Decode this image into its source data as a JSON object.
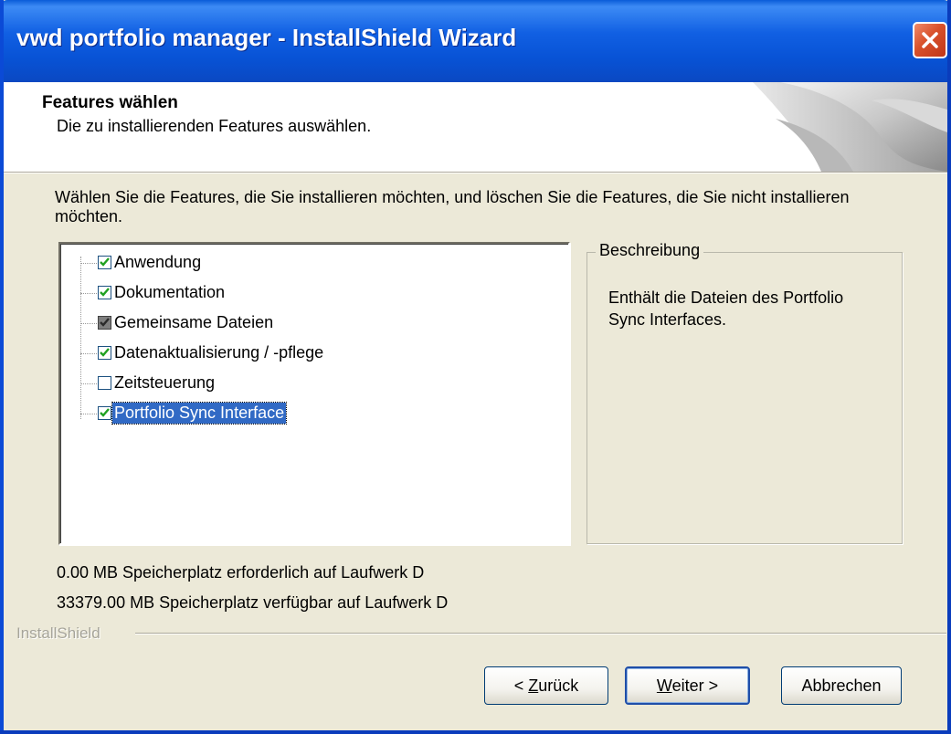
{
  "window": {
    "title": "vwd portfolio manager - InstallShield Wizard"
  },
  "header": {
    "title": "Features wählen",
    "subtitle": "Die zu installierenden Features auswählen."
  },
  "intro_text": "Wählen Sie die Features, die Sie installieren möchten, und löschen Sie die Features, die Sie nicht installieren möchten.",
  "features": [
    {
      "label": "Anwendung",
      "state": "checked"
    },
    {
      "label": "Dokumentation",
      "state": "checked"
    },
    {
      "label": "Gemeinsame Dateien",
      "state": "partial"
    },
    {
      "label": "Datenaktualisierung / -pflege",
      "state": "checked"
    },
    {
      "label": "Zeitsteuerung",
      "state": "unchecked"
    },
    {
      "label": "Portfolio Sync Interface",
      "state": "checked",
      "selected": true
    }
  ],
  "description": {
    "legend": "Beschreibung",
    "text": "Enthält die Dateien des Portfolio Sync Interfaces."
  },
  "disk_space": {
    "required": "0.00 MB Speicherplatz erforderlich auf Laufwerk D",
    "available": "33379.00 MB Speicherplatz verfügbar auf Laufwerk D"
  },
  "branding": "InstallShield",
  "buttons": {
    "back_prefix": "< ",
    "back_mnemonic": "Z",
    "back_rest": "urück",
    "next_mnemonic": "W",
    "next_rest": "eiter >",
    "cancel": "Abbrechen"
  },
  "colors": {
    "titlebar": "#0853d6",
    "selection": "#316ac5",
    "dialog_bg": "#ece9d8"
  }
}
